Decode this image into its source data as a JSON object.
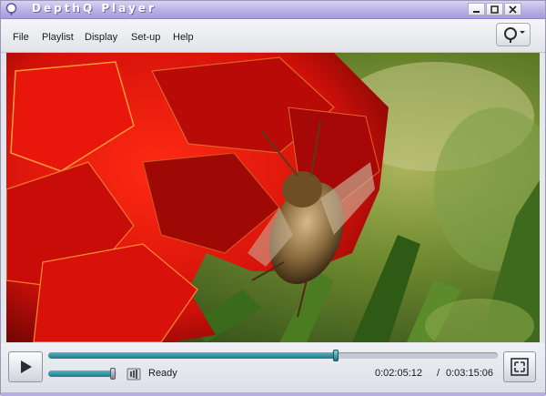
{
  "window": {
    "title": "DepthQ Player",
    "accent": "#b3a9e2",
    "buttons": [
      "minimize",
      "maximize",
      "close"
    ]
  },
  "menu": {
    "items": [
      "File",
      "Playlist",
      "Display",
      "Set-up",
      "Help"
    ]
  },
  "toolbar": {
    "search_icon": "magnifier-dropdown-icon"
  },
  "video": {
    "content": "video frame"
  },
  "playback": {
    "play_icon": "play-icon",
    "progress": 0.64,
    "volume": 0.94,
    "status": "Ready",
    "current_time": "0:02:05:12",
    "separator": "/",
    "total_time": "0:03:15:06",
    "fullscreen_icon": "fullscreen-icon"
  }
}
